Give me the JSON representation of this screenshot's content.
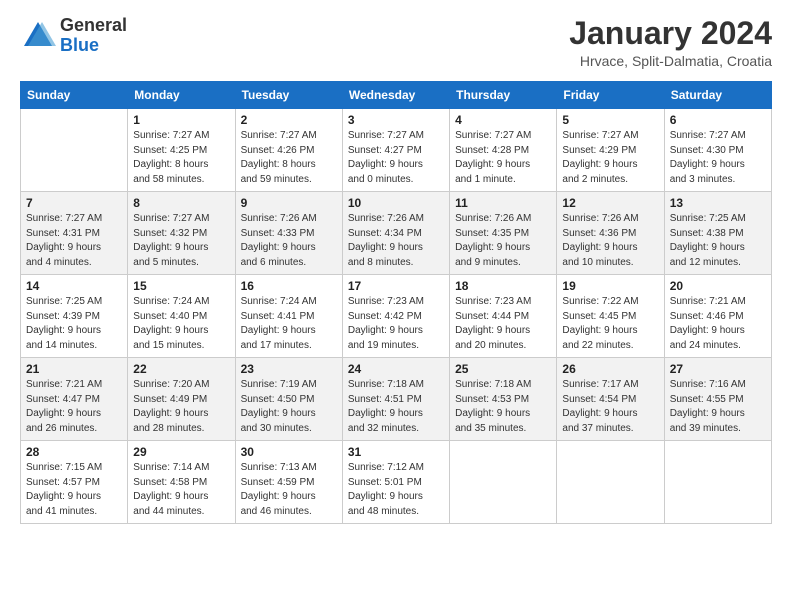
{
  "logo": {
    "general": "General",
    "blue": "Blue"
  },
  "header": {
    "month_year": "January 2024",
    "location": "Hrvace, Split-Dalmatia, Croatia"
  },
  "days_of_week": [
    "Sunday",
    "Monday",
    "Tuesday",
    "Wednesday",
    "Thursday",
    "Friday",
    "Saturday"
  ],
  "weeks": [
    [
      {
        "day": "",
        "info": ""
      },
      {
        "day": "1",
        "info": "Sunrise: 7:27 AM\nSunset: 4:25 PM\nDaylight: 8 hours\nand 58 minutes."
      },
      {
        "day": "2",
        "info": "Sunrise: 7:27 AM\nSunset: 4:26 PM\nDaylight: 8 hours\nand 59 minutes."
      },
      {
        "day": "3",
        "info": "Sunrise: 7:27 AM\nSunset: 4:27 PM\nDaylight: 9 hours\nand 0 minutes."
      },
      {
        "day": "4",
        "info": "Sunrise: 7:27 AM\nSunset: 4:28 PM\nDaylight: 9 hours\nand 1 minute."
      },
      {
        "day": "5",
        "info": "Sunrise: 7:27 AM\nSunset: 4:29 PM\nDaylight: 9 hours\nand 2 minutes."
      },
      {
        "day": "6",
        "info": "Sunrise: 7:27 AM\nSunset: 4:30 PM\nDaylight: 9 hours\nand 3 minutes."
      }
    ],
    [
      {
        "day": "7",
        "info": "Sunrise: 7:27 AM\nSunset: 4:31 PM\nDaylight: 9 hours\nand 4 minutes."
      },
      {
        "day": "8",
        "info": "Sunrise: 7:27 AM\nSunset: 4:32 PM\nDaylight: 9 hours\nand 5 minutes."
      },
      {
        "day": "9",
        "info": "Sunrise: 7:26 AM\nSunset: 4:33 PM\nDaylight: 9 hours\nand 6 minutes."
      },
      {
        "day": "10",
        "info": "Sunrise: 7:26 AM\nSunset: 4:34 PM\nDaylight: 9 hours\nand 8 minutes."
      },
      {
        "day": "11",
        "info": "Sunrise: 7:26 AM\nSunset: 4:35 PM\nDaylight: 9 hours\nand 9 minutes."
      },
      {
        "day": "12",
        "info": "Sunrise: 7:26 AM\nSunset: 4:36 PM\nDaylight: 9 hours\nand 10 minutes."
      },
      {
        "day": "13",
        "info": "Sunrise: 7:25 AM\nSunset: 4:38 PM\nDaylight: 9 hours\nand 12 minutes."
      }
    ],
    [
      {
        "day": "14",
        "info": "Sunrise: 7:25 AM\nSunset: 4:39 PM\nDaylight: 9 hours\nand 14 minutes."
      },
      {
        "day": "15",
        "info": "Sunrise: 7:24 AM\nSunset: 4:40 PM\nDaylight: 9 hours\nand 15 minutes."
      },
      {
        "day": "16",
        "info": "Sunrise: 7:24 AM\nSunset: 4:41 PM\nDaylight: 9 hours\nand 17 minutes."
      },
      {
        "day": "17",
        "info": "Sunrise: 7:23 AM\nSunset: 4:42 PM\nDaylight: 9 hours\nand 19 minutes."
      },
      {
        "day": "18",
        "info": "Sunrise: 7:23 AM\nSunset: 4:44 PM\nDaylight: 9 hours\nand 20 minutes."
      },
      {
        "day": "19",
        "info": "Sunrise: 7:22 AM\nSunset: 4:45 PM\nDaylight: 9 hours\nand 22 minutes."
      },
      {
        "day": "20",
        "info": "Sunrise: 7:21 AM\nSunset: 4:46 PM\nDaylight: 9 hours\nand 24 minutes."
      }
    ],
    [
      {
        "day": "21",
        "info": "Sunrise: 7:21 AM\nSunset: 4:47 PM\nDaylight: 9 hours\nand 26 minutes."
      },
      {
        "day": "22",
        "info": "Sunrise: 7:20 AM\nSunset: 4:49 PM\nDaylight: 9 hours\nand 28 minutes."
      },
      {
        "day": "23",
        "info": "Sunrise: 7:19 AM\nSunset: 4:50 PM\nDaylight: 9 hours\nand 30 minutes."
      },
      {
        "day": "24",
        "info": "Sunrise: 7:18 AM\nSunset: 4:51 PM\nDaylight: 9 hours\nand 32 minutes."
      },
      {
        "day": "25",
        "info": "Sunrise: 7:18 AM\nSunset: 4:53 PM\nDaylight: 9 hours\nand 35 minutes."
      },
      {
        "day": "26",
        "info": "Sunrise: 7:17 AM\nSunset: 4:54 PM\nDaylight: 9 hours\nand 37 minutes."
      },
      {
        "day": "27",
        "info": "Sunrise: 7:16 AM\nSunset: 4:55 PM\nDaylight: 9 hours\nand 39 minutes."
      }
    ],
    [
      {
        "day": "28",
        "info": "Sunrise: 7:15 AM\nSunset: 4:57 PM\nDaylight: 9 hours\nand 41 minutes."
      },
      {
        "day": "29",
        "info": "Sunrise: 7:14 AM\nSunset: 4:58 PM\nDaylight: 9 hours\nand 44 minutes."
      },
      {
        "day": "30",
        "info": "Sunrise: 7:13 AM\nSunset: 4:59 PM\nDaylight: 9 hours\nand 46 minutes."
      },
      {
        "day": "31",
        "info": "Sunrise: 7:12 AM\nSunset: 5:01 PM\nDaylight: 9 hours\nand 48 minutes."
      },
      {
        "day": "",
        "info": ""
      },
      {
        "day": "",
        "info": ""
      },
      {
        "day": "",
        "info": ""
      }
    ]
  ]
}
